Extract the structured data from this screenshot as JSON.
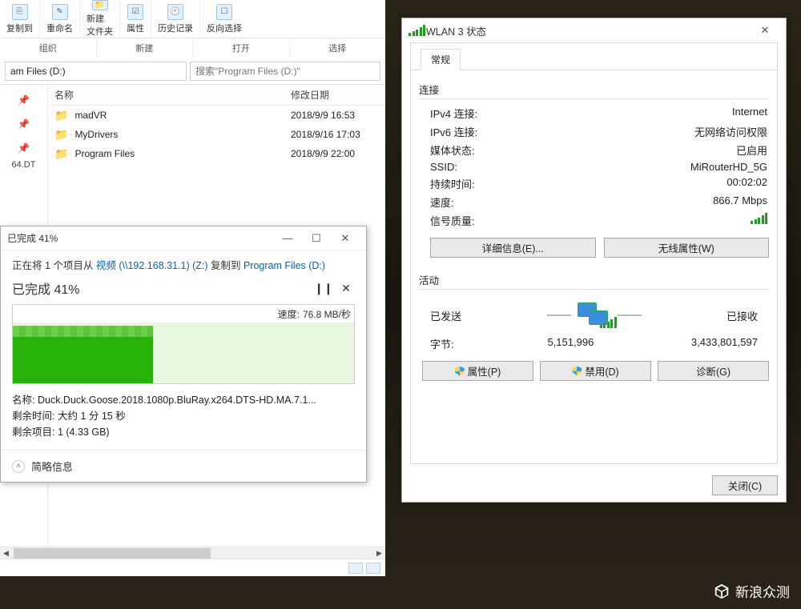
{
  "explorer": {
    "ribbon": {
      "items": [
        {
          "label": "复制到"
        },
        {
          "label": "重命名"
        },
        {
          "label": "新建\n文件夹"
        },
        {
          "label": "属性"
        },
        {
          "label": "历史记录"
        },
        {
          "label": "反向选择"
        }
      ],
      "groups": [
        "组织",
        "新建",
        "打开",
        "选择"
      ]
    },
    "address": "am Files (D:)",
    "search_placeholder": "搜索\"Program Files (D:)\"",
    "columns": {
      "name": "名称",
      "date": "修改日期"
    },
    "files": [
      {
        "name": "madVR",
        "date": "2018/9/9 16:53"
      },
      {
        "name": "MyDrivers",
        "date": "2018/9/16 17:03"
      },
      {
        "name": "Program Files",
        "date": "2018/9/9 22:00"
      }
    ],
    "pin_label": "64.DT"
  },
  "copy": {
    "title": "已完成 41%",
    "prefix": "正在将 1 个项目从 ",
    "src": "视频 (\\\\192.168.31.1) (Z:)",
    "mid": " 复制到 ",
    "dst": "Program Files (D:)",
    "progress_text": "已完成 41%",
    "speed_label": "速度:",
    "speed_value": "76.8 MB/秒",
    "name_label": "名称:",
    "name_value": "Duck.Duck.Goose.2018.1080p.BluRay.x264.DTS-HD.MA.7.1...",
    "remain_time_label": "剩余时间:",
    "remain_time_value": "大约 1 分 15 秒",
    "remain_items_label": "剩余项目:",
    "remain_items_value": "1 (4.33 GB)",
    "more": "简略信息",
    "progress_percent": 41
  },
  "wlan": {
    "title": "WLAN 3 状态",
    "tab": "常规",
    "sect_connection": "连接",
    "kv": {
      "ipv4_k": "IPv4 连接:",
      "ipv4_v": "Internet",
      "ipv6_k": "IPv6 连接:",
      "ipv6_v": "无网络访问权限",
      "media_k": "媒体状态:",
      "media_v": "已启用",
      "ssid_k": "SSID:",
      "ssid_v": "MiRouterHD_5G",
      "dur_k": "持续时间:",
      "dur_v": "00:02:02",
      "speed_k": "速度:",
      "speed_v": "866.7 Mbps",
      "sig_k": "信号质量:"
    },
    "btn_detail": "详细信息(E)...",
    "btn_wireless": "无线属性(W)",
    "sect_activity": "活动",
    "sent": "已发送",
    "recv": "已接收",
    "bytes_label": "字节:",
    "bytes_sent": "5,151,996",
    "bytes_recv": "3,433,801,597",
    "btn_prop": "属性(P)",
    "btn_disable": "禁用(D)",
    "btn_diag": "诊断(G)",
    "btn_close": "关闭(C)"
  },
  "watermark": "新浪众测"
}
